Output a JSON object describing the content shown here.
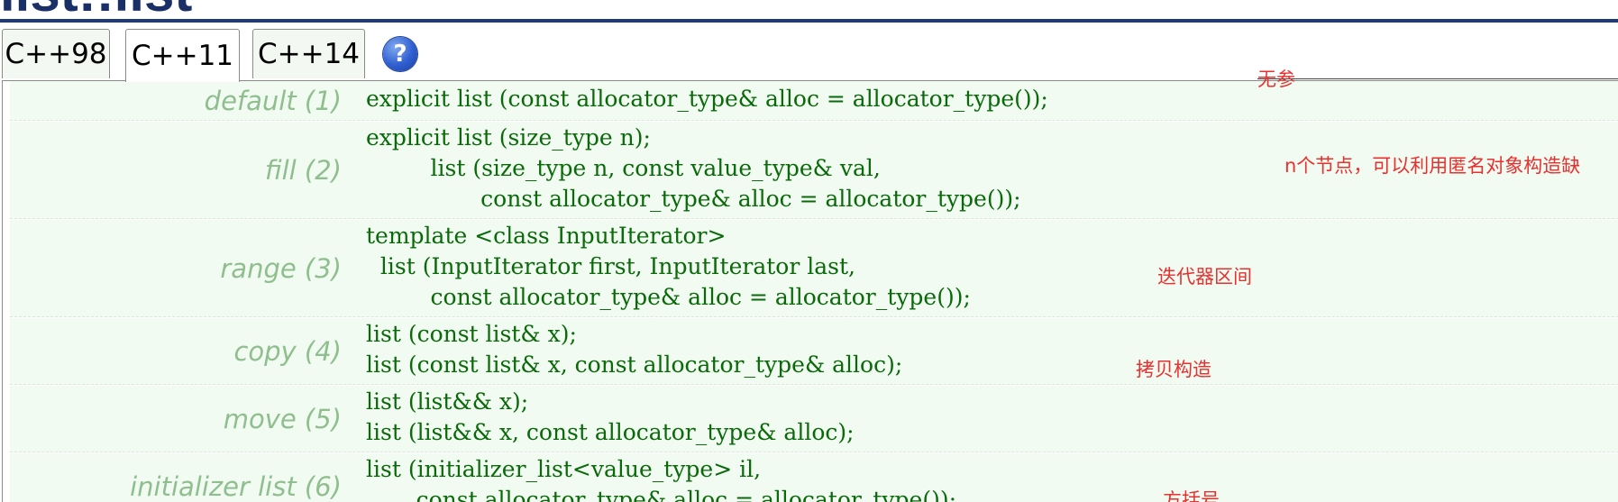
{
  "page": {
    "title": "list::list"
  },
  "tabs": [
    {
      "label": "C++98",
      "active": false
    },
    {
      "label": "C++11",
      "active": true
    },
    {
      "label": "C++14",
      "active": false
    }
  ],
  "help_icon": {
    "glyph": "?"
  },
  "rows": [
    {
      "label": "default (1)",
      "lines": [
        "explicit list (const allocator_type& alloc = allocator_type());"
      ]
    },
    {
      "label": "fill (2)",
      "lines": [
        "explicit list (size_type n);",
        "         list (size_type n, const value_type& val,",
        "                const allocator_type& alloc = allocator_type());"
      ]
    },
    {
      "label": "range (3)",
      "lines": [
        "template <class InputIterator>",
        "  list (InputIterator first, InputIterator last,",
        "         const allocator_type& alloc = allocator_type());"
      ]
    },
    {
      "label": "copy (4)",
      "lines": [
        "list (const list& x);",
        "list (const list& x, const allocator_type& alloc);"
      ]
    },
    {
      "label": "move (5)",
      "lines": [
        "list (list&& x);",
        "list (list&& x, const allocator_type& alloc);"
      ]
    },
    {
      "label": "initializer list (6)",
      "lines": [
        "list (initializer_list<value_type> il,",
        "       const allocator_type& alloc = allocator_type());"
      ]
    }
  ],
  "annotations": [
    {
      "text": "无参"
    },
    {
      "text": "n个节点，可以利用匿名对象构造缺"
    },
    {
      "text": "迭代器区间"
    },
    {
      "text": "拷贝构造"
    },
    {
      "text": "方括号"
    }
  ],
  "colors": {
    "title": "#1a2f66",
    "rule": "#1f3a7a",
    "row_bg": "#f2fbf2",
    "label": "#8fbe8f",
    "code": "#0a6a0a",
    "annotation": "#e8302f"
  }
}
